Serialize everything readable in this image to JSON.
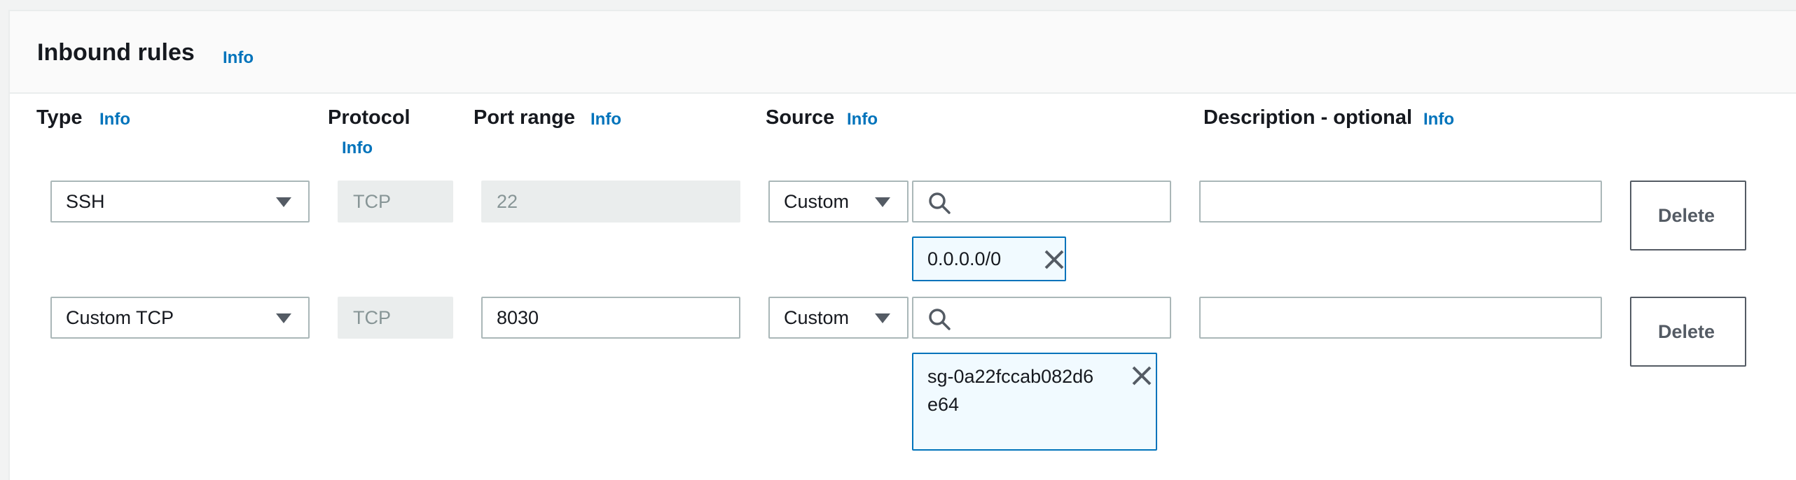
{
  "header": {
    "title": "Inbound rules",
    "info": "Info"
  },
  "columns": {
    "type": {
      "label": "Type",
      "info": "Info"
    },
    "protocol": {
      "label": "Protocol",
      "info": "Info"
    },
    "port_range": {
      "label": "Port range",
      "info": "Info"
    },
    "source": {
      "label": "Source",
      "info": "Info"
    },
    "description": {
      "label": "Description - optional",
      "info": "Info"
    }
  },
  "rules": [
    {
      "type": "SSH",
      "protocol": "TCP",
      "port_range": "22",
      "source_type": "Custom",
      "source_search_value": "",
      "source_token": "0.0.0.0/0",
      "description": "",
      "delete_label": "Delete"
    },
    {
      "type": "Custom TCP",
      "protocol": "TCP",
      "port_range": "8030",
      "source_type": "Custom",
      "source_search_value": "",
      "source_token": "sg-0a22fccab082d6e64",
      "description": "",
      "delete_label": "Delete"
    }
  ],
  "colors": {
    "accent": "#0073bb",
    "border": "#aab7b8",
    "disabled_bg": "#eaeded",
    "token_bg": "#f1faff"
  }
}
